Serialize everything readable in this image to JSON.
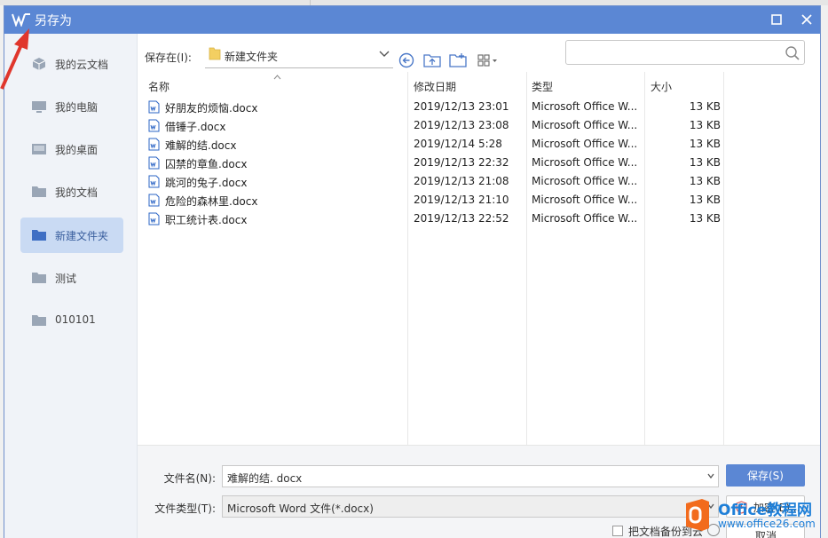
{
  "colors": {
    "accent": "#5b87d4",
    "sidebar_bg": "#f0f3f8",
    "sidebar_active": "#c9daf3",
    "docx_icon": "#2b64c5",
    "annotation": "#e0362c",
    "watermark_orange": "#f26b1d",
    "watermark_blue": "#1e7fd8"
  },
  "window": {
    "title": "另存为",
    "logo_icon": "wps-logo-icon",
    "maximize_icon": "maximize-icon",
    "close_icon": "close-icon"
  },
  "sidebar": {
    "items": [
      {
        "label": "我的云文档",
        "icon": "cloud-document-icon",
        "active": false
      },
      {
        "label": "我的电脑",
        "icon": "computer-icon",
        "active": false
      },
      {
        "label": "我的桌面",
        "icon": "desktop-icon",
        "active": false
      },
      {
        "label": "我的文档",
        "icon": "folder-icon",
        "active": false
      },
      {
        "label": "新建文件夹",
        "icon": "folder-icon",
        "active": true
      },
      {
        "label": "测试",
        "icon": "folder-icon",
        "active": false
      },
      {
        "label": "010101",
        "icon": "folder-icon",
        "active": false
      }
    ]
  },
  "toolbar": {
    "save_in_label": "保存在(I):",
    "current_folder": "新建文件夹",
    "back_icon": "back-icon",
    "up_folder_icon": "up-folder-icon",
    "new_folder_icon": "new-folder-icon",
    "view_icon": "view-grid-icon",
    "search_placeholder": ""
  },
  "filelist": {
    "columns": {
      "name": "名称",
      "modified": "修改日期",
      "type": "类型",
      "size": "大小"
    },
    "rows": [
      {
        "name": "好朋友的烦恼.docx",
        "modified": "2019/12/13 23:01",
        "type": "Microsoft Office W...",
        "size": "13 KB"
      },
      {
        "name": "借锤子.docx",
        "modified": "2019/12/13 23:08",
        "type": "Microsoft Office W...",
        "size": "13 KB"
      },
      {
        "name": "难解的结.docx",
        "modified": "2019/12/14 5:28",
        "type": "Microsoft Office W...",
        "size": "13 KB"
      },
      {
        "name": "囚禁的章鱼.docx",
        "modified": "2019/12/13 22:32",
        "type": "Microsoft Office W...",
        "size": "13 KB"
      },
      {
        "name": "跳河的兔子.docx",
        "modified": "2019/12/13 21:08",
        "type": "Microsoft Office W...",
        "size": "13 KB"
      },
      {
        "name": "危险的森林里.docx",
        "modified": "2019/12/13 21:10",
        "type": "Microsoft Office W...",
        "size": "13 KB"
      },
      {
        "name": "职工统计表.docx",
        "modified": "2019/12/13 22:52",
        "type": "Microsoft Office W...",
        "size": "13 KB"
      }
    ]
  },
  "bottom": {
    "filename_label": "文件名(N):",
    "filename_value": "难解的结. docx",
    "filetype_label": "文件类型(T):",
    "filetype_value": "Microsoft Word 文件(*.docx)",
    "save_button": "保存(S)",
    "encrypt_button": "加密(E)...",
    "cancel_button": "取消",
    "backup_label": "把文档备份到云"
  },
  "watermark": {
    "name": "Office教程网",
    "url": "www.office26.com"
  }
}
